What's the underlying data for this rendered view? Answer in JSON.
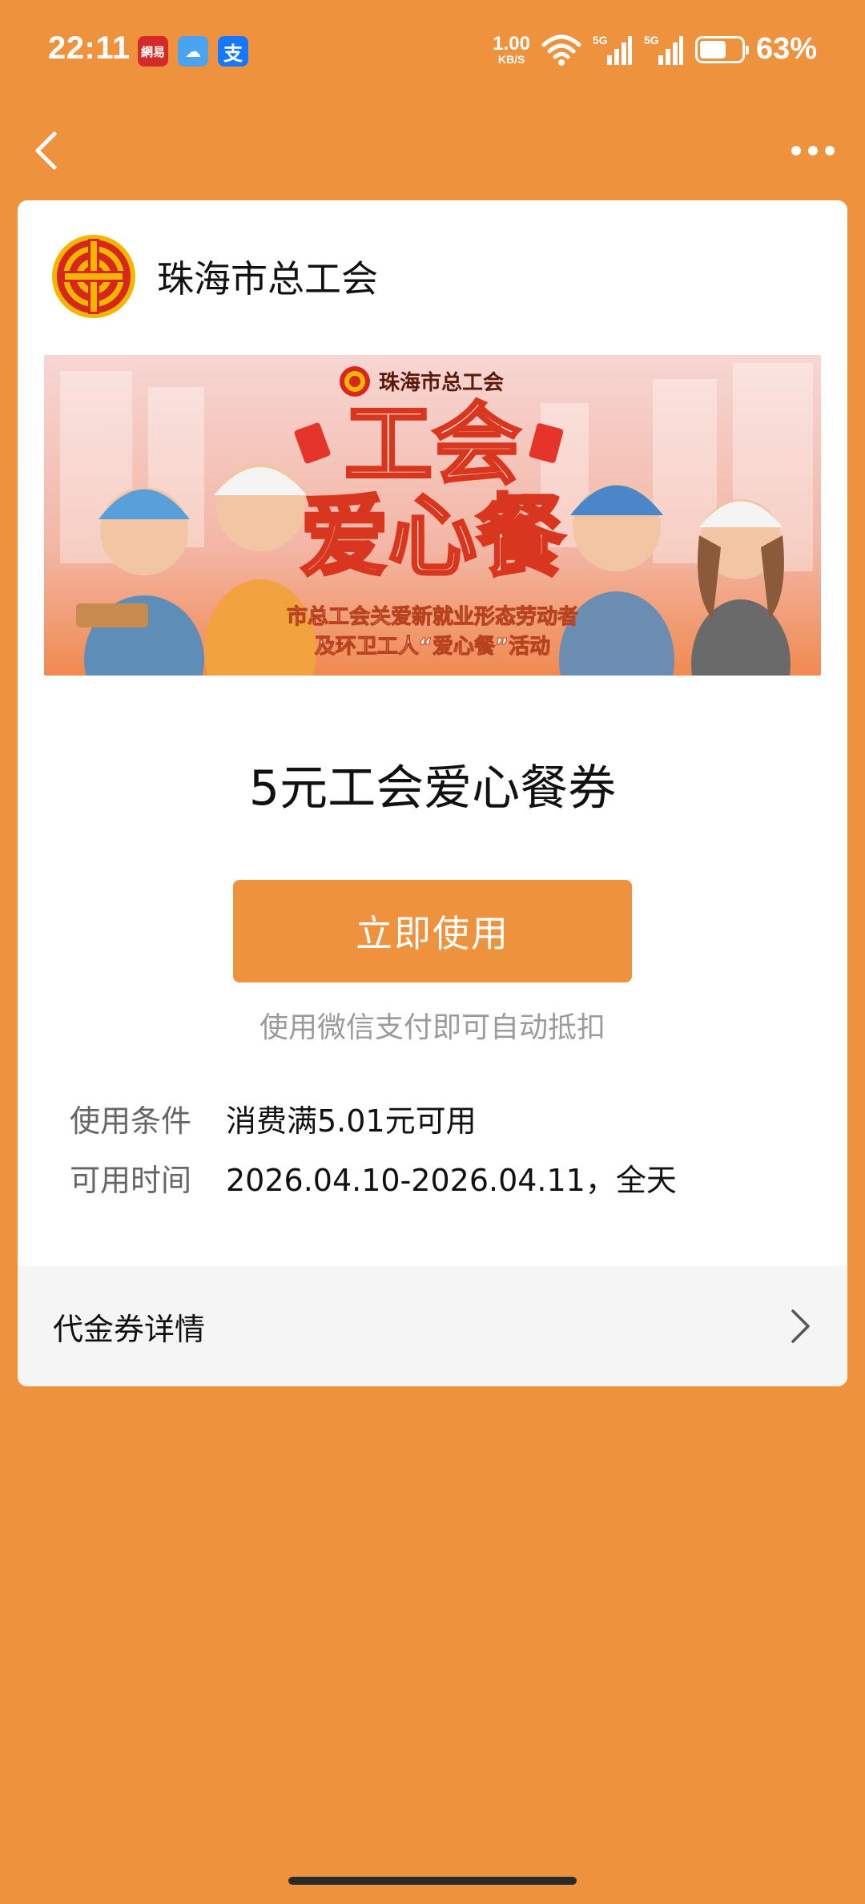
{
  "status_bar": {
    "time": "22:11",
    "app_icons": [
      {
        "name": "netease-news",
        "glyph": "網易"
      },
      {
        "name": "weather",
        "glyph": "☁"
      },
      {
        "name": "alipay",
        "glyph": "支"
      }
    ],
    "net_speed_value": "1.00",
    "net_speed_unit": "KB/S",
    "signal_1_label": "5G",
    "signal_2_label": "5G",
    "battery_level": 0.63,
    "battery_text": "63%"
  },
  "nav": {
    "back_icon": "chevron-left-icon",
    "more_icon": "more-horizontal-icon"
  },
  "header": {
    "org_name": "珠海市总工会"
  },
  "banner": {
    "org_name": "珠海市总工会",
    "title_line1": "工会",
    "title_line2": "爱心餐",
    "subtitle_line1": "市总工会关爱新就业形态劳动者",
    "subtitle_line2": "及环卫工人“爱心餐”活动"
  },
  "coupon": {
    "title": "5元工会爱心餐券",
    "use_button_label": "立即使用",
    "hint": "使用微信支付即可自动抵扣",
    "conditions_label": "使用条件",
    "conditions_value": "消费满5.01元可用",
    "time_label": "可用时间",
    "time_value": "2026.04.10-2026.04.11，全天"
  },
  "detail": {
    "label": "代金券详情",
    "chevron_icon": "chevron-right-icon"
  },
  "colors": {
    "accent": "#EE923E",
    "card": "#FFFFFF",
    "hint_gray": "#9B9B9B"
  }
}
